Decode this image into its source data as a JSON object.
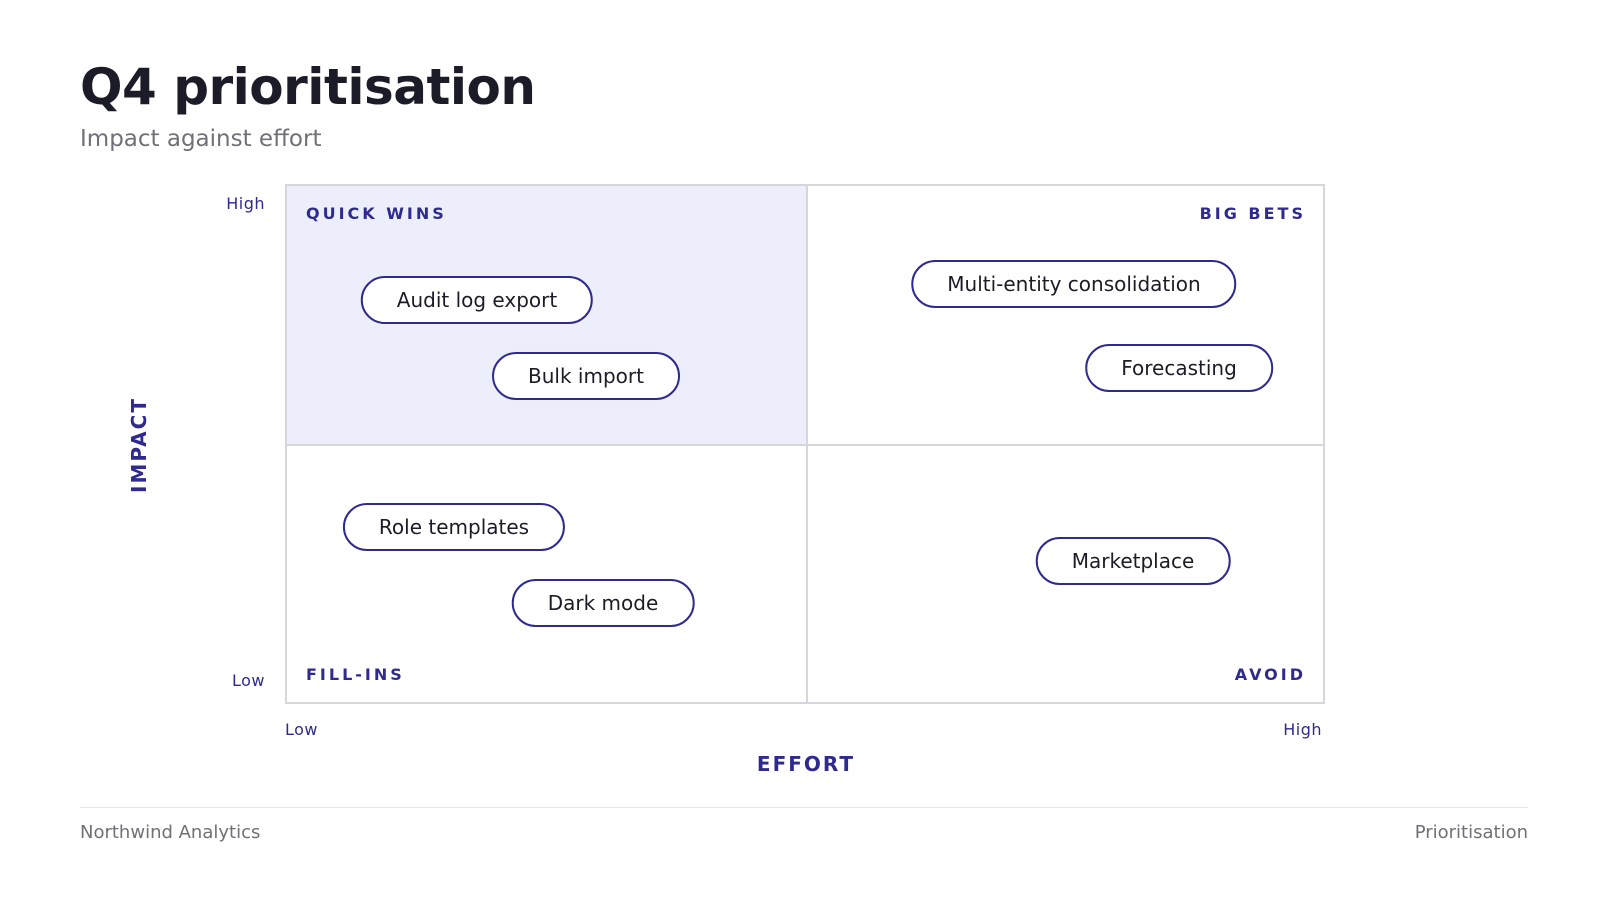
{
  "header": {
    "title": "Q4 prioritisation",
    "subtitle": "Impact against effort"
  },
  "axes": {
    "y_title": "IMPACT",
    "y_high": "High",
    "y_low": "Low",
    "x_title": "EFFORT",
    "x_low": "Low",
    "x_high": "High"
  },
  "quadrants": {
    "quick_wins": "QUICK WINS",
    "big_bets": "BIG BETS",
    "fill_ins": "FILL-INS",
    "avoid": "AVOID",
    "highlight_color": "#eceffb"
  },
  "items": [
    {
      "label": "Audit log export",
      "quadrant": "quick_wins"
    },
    {
      "label": "Bulk import",
      "quadrant": "quick_wins"
    },
    {
      "label": "Multi-entity consolidation",
      "quadrant": "big_bets"
    },
    {
      "label": "Forecasting",
      "quadrant": "big_bets"
    },
    {
      "label": "Role templates",
      "quadrant": "fill_ins"
    },
    {
      "label": "Dark mode",
      "quadrant": "fill_ins"
    },
    {
      "label": "Marketplace",
      "quadrant": "avoid"
    }
  ],
  "footer": {
    "left": "Northwind Analytics",
    "right": "Prioritisation"
  },
  "colors": {
    "accent": "#2e2a8f",
    "text": "#1c1c28",
    "muted": "#707078",
    "border": "#d6d6de"
  }
}
